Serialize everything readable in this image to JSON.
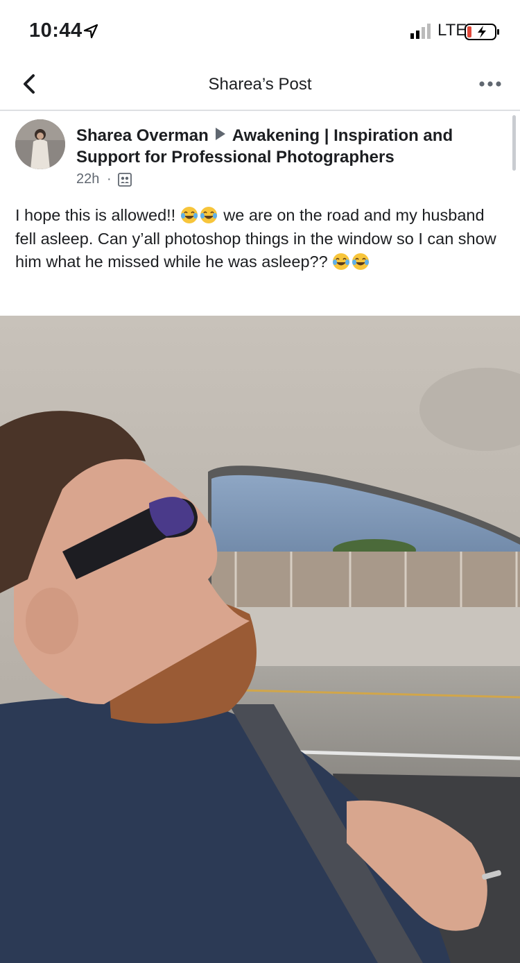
{
  "status_bar": {
    "time": "10:44",
    "carrier": "LTE",
    "icons": [
      "location-arrow-icon",
      "signal-icon",
      "battery-charging-icon"
    ]
  },
  "nav": {
    "title": "Sharea’s Post",
    "icons": [
      "back-chevron-icon",
      "more-icon"
    ]
  },
  "post": {
    "author": "Sharea Overman",
    "group": "Awakening | Inspiration and Support for Professional Photographers",
    "time": "22h",
    "separator": "·",
    "text_1": "I hope this is allowed!!",
    "text_2": "we are on the road and my husband fell asleep. Can y’all photoshop things in the window so I can show him what he missed while he was asleep??",
    "emoji": "tears-of-joy-emoji"
  },
  "colors": {
    "text": "#1c1e21",
    "meta": "#606770",
    "divider": "#dddfe2",
    "battery_red": "#e0483a"
  }
}
